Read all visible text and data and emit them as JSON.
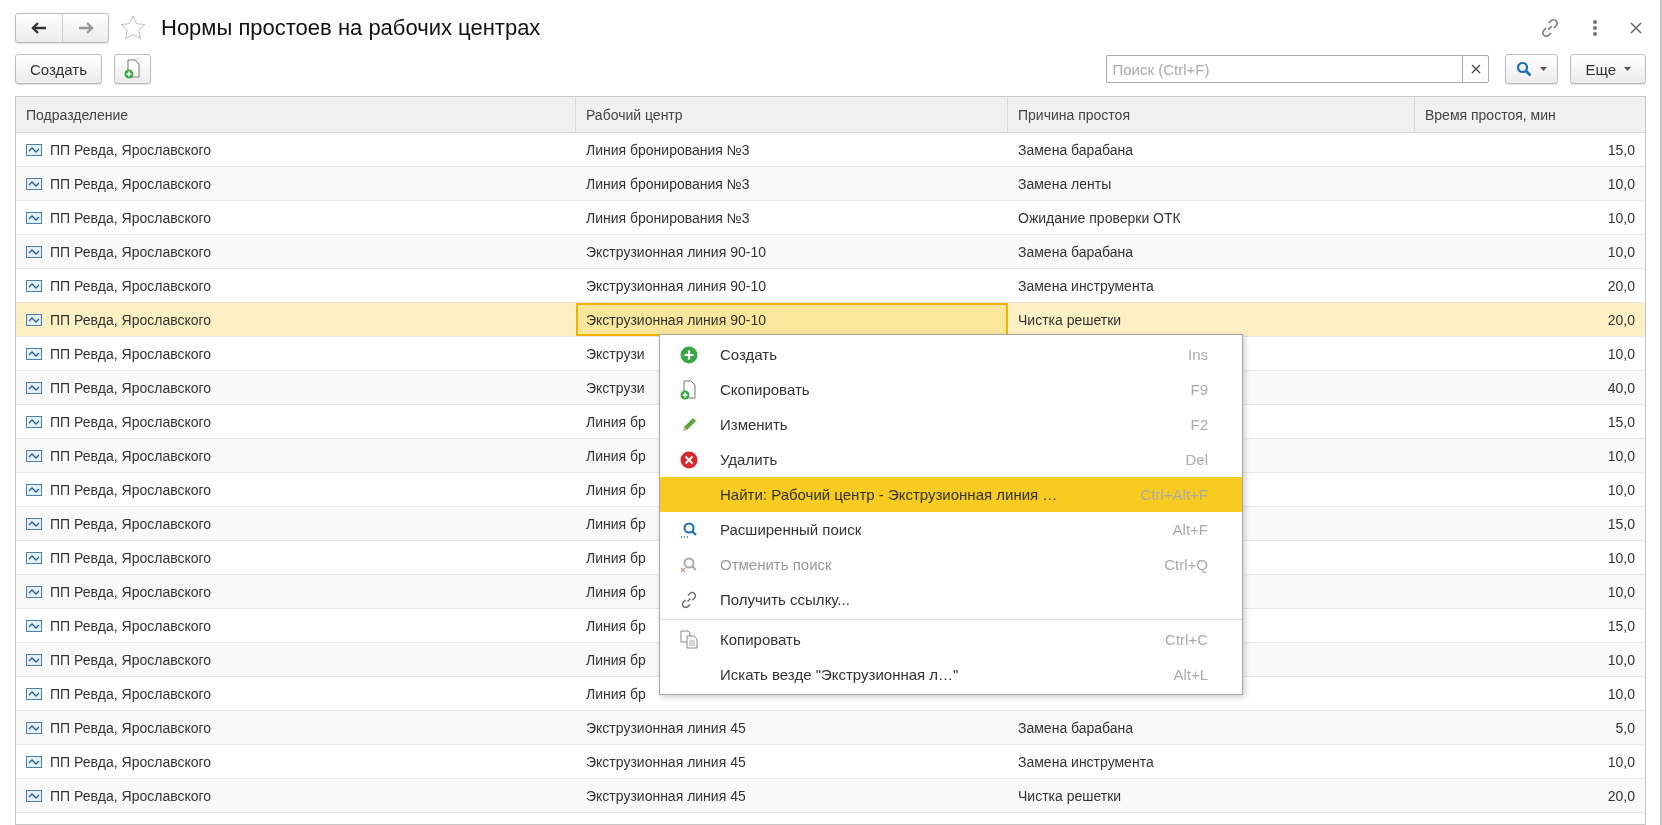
{
  "window": {
    "title": "Нормы простоев на рабочих центрах",
    "favorite": false
  },
  "toolbar": {
    "create_button": "Создать",
    "search": {
      "placeholder": "Поиск (Ctrl+F)"
    },
    "more_button": "Еще"
  },
  "table": {
    "columns": [
      {
        "kind": "unit",
        "title": "Подразделение",
        "focused": false
      },
      {
        "kind": "work_center",
        "title": "Рабочий центр",
        "focused": true
      },
      {
        "kind": "reason",
        "title": "Причина простоя",
        "focused": false
      },
      {
        "kind": "time",
        "title": "Время простоя, мин",
        "focused": false
      }
    ],
    "rows": [
      {
        "unit": "ПП Ревда, Ярославского",
        "work_center": "Линия бронирования №3",
        "reason": "Замена барабана",
        "time": "15,0",
        "selected": false
      },
      {
        "unit": "ПП Ревда, Ярославского",
        "work_center": "Линия бронирования №3",
        "reason": "Замена ленты",
        "time": "10,0",
        "selected": false
      },
      {
        "unit": "ПП Ревда, Ярославского",
        "work_center": "Линия бронирования №3",
        "reason": "Ожидание проверки ОТК",
        "time": "10,0",
        "selected": false
      },
      {
        "unit": "ПП Ревда, Ярославского",
        "work_center": "Экструзионная линия 90-10",
        "reason": "Замена барабана",
        "time": "10,0",
        "selected": false
      },
      {
        "unit": "ПП Ревда, Ярославского",
        "work_center": "Экструзионная линия 90-10",
        "reason": "Замена инструмента",
        "time": "20,0",
        "selected": false
      },
      {
        "unit": "ПП Ревда, Ярославского",
        "work_center": "Экструзионная линия 90-10",
        "reason": "Чистка решетки",
        "time": "20,0",
        "selected": true
      },
      {
        "unit": "ПП Ревда, Ярославского",
        "work_center": "Экструзи",
        "time": "10,0",
        "selected": false
      },
      {
        "unit": "ПП Ревда, Ярославского",
        "work_center": "Экструзи",
        "time": "40,0",
        "selected": false
      },
      {
        "unit": "ПП Ревда, Ярославского",
        "work_center": "Линия бр",
        "time": "15,0",
        "selected": false
      },
      {
        "unit": "ПП Ревда, Ярославского",
        "work_center": "Линия бр",
        "time": "10,0",
        "selected": false
      },
      {
        "unit": "ПП Ревда, Ярославского",
        "work_center": "Линия бр",
        "time": "10,0",
        "selected": false
      },
      {
        "unit": "ПП Ревда, Ярославского",
        "work_center": "Линия бр",
        "time": "15,0",
        "selected": false
      },
      {
        "unit": "ПП Ревда, Ярославского",
        "work_center": "Линия бр",
        "time": "10,0",
        "selected": false
      },
      {
        "unit": "ПП Ревда, Ярославского",
        "work_center": "Линия бр",
        "time": "10,0",
        "selected": false
      },
      {
        "unit": "ПП Ревда, Ярославского",
        "work_center": "Линия бр",
        "time": "15,0",
        "selected": false
      },
      {
        "unit": "ПП Ревда, Ярославского",
        "work_center": "Линия бр",
        "time": "10,0",
        "selected": false
      },
      {
        "unit": "ПП Ревда, Ярославского",
        "work_center": "Линия бр",
        "time": "10,0",
        "selected": false
      },
      {
        "unit": "ПП Ревда, Ярославского",
        "work_center": "Экструзионная линия 45",
        "reason": "Замена барабана",
        "time": "5,0",
        "selected": false
      },
      {
        "unit": "ПП Ревда, Ярославского",
        "work_center": "Экструзионная линия 45",
        "reason": "Замена инструмента",
        "time": "10,0",
        "selected": false
      },
      {
        "unit": "ПП Ревда, Ярославского",
        "work_center": "Экструзионная линия 45",
        "reason": "Чистка решетки",
        "time": "20,0",
        "selected": false
      }
    ]
  },
  "context_menu": {
    "items": [
      {
        "kind": "item",
        "label": "Создать",
        "shortcut": "Ins",
        "selected": false,
        "disabled": false
      },
      {
        "kind": "item",
        "label": "Скопировать",
        "shortcut": "F9",
        "selected": false,
        "disabled": false
      },
      {
        "kind": "item",
        "label": "Изменить",
        "shortcut": "F2",
        "selected": false,
        "disabled": false
      },
      {
        "kind": "item",
        "label": "Удалить",
        "shortcut": "Del",
        "selected": false,
        "disabled": false
      },
      {
        "kind": "item",
        "label": "Найти: Рабочий центр - Экструзионная линия …",
        "shortcut": "Ctrl+Alt+F",
        "selected": true,
        "disabled": false
      },
      {
        "kind": "item",
        "label": "Расширенный поиск",
        "shortcut": "Alt+F",
        "selected": false,
        "disabled": false
      },
      {
        "kind": "item",
        "label": "Отменить поиск",
        "shortcut": "Ctrl+Q",
        "selected": false,
        "disabled": true
      },
      {
        "kind": "item",
        "label": "Получить ссылку...",
        "selected": false,
        "disabled": false
      },
      {
        "kind": "separator"
      },
      {
        "kind": "item",
        "label": "Копировать",
        "shortcut": "Ctrl+C",
        "selected": false,
        "disabled": false
      },
      {
        "kind": "item",
        "label": "Искать везде \"Экструзионная л…\"",
        "shortcut": "Alt+L",
        "selected": false,
        "disabled": false
      }
    ]
  }
}
